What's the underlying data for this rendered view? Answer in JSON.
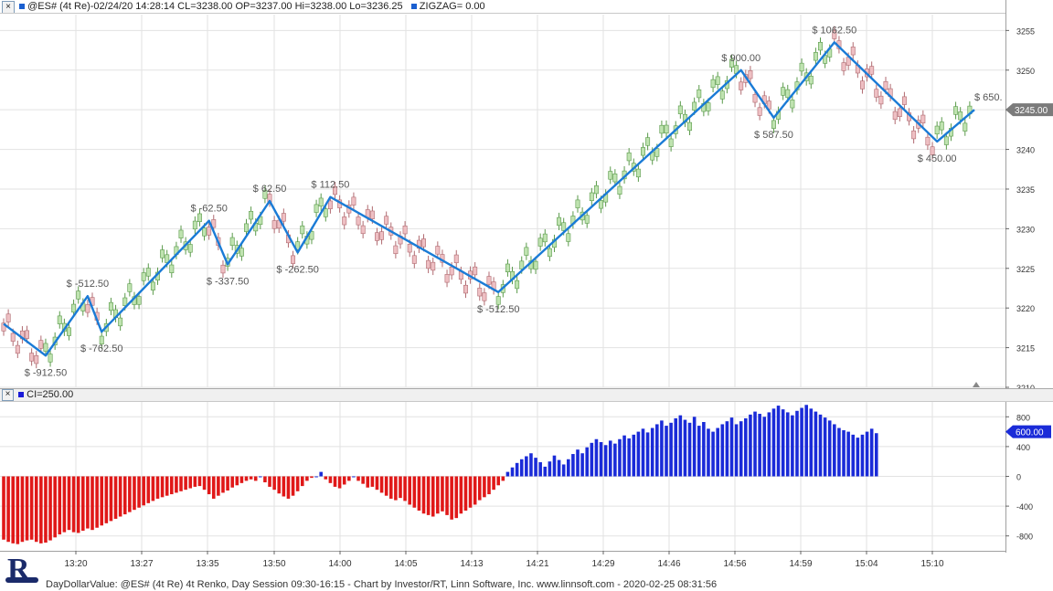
{
  "header": {
    "close_glyph": "×",
    "title": "@ES# (4t Re)-02/24/20 14:28:14 CL=3238.00 OP=3237.00 Hi=3238.00 Lo=3236.25",
    "indicator_label": "ZIGZAG= 0.00",
    "indicator_color": "#1a5fd0"
  },
  "lower_header": {
    "close_glyph": "×",
    "indicator_label": "CI=250.00",
    "indicator_color": "#1a1ad8"
  },
  "footer": {
    "text": "DayDollarValue: @ES# (4t Re) 4t Renko, Day Session 09:30-16:15 - Chart by Investor/RT, Linn Software, Inc. www.linnsoft.com - 2020-02-25 08:31:56",
    "logo_letter": "R"
  },
  "colors": {
    "up_brick": "#bfe3b0",
    "up_border": "#5a9a4a",
    "down_brick": "#eebfc3",
    "down_border": "#b06a70",
    "zigzag": "#1a7bd6",
    "pos_bar": "#1a2bd8",
    "neg_bar": "#e01818",
    "grid": "#e2e2e2",
    "axis_bg": "#ffffff",
    "price_marker_bg": "#7b7b7b",
    "ci_marker_bg": "#1a2bd8"
  },
  "chart_data": [
    {
      "type": "renko-candlestick",
      "title": "@ES# (4t Re)-02/24/20 14:28:14 CL=3238.00 OP=3237.00 Hi=3238.00 Lo=3236.25",
      "ylim": [
        3210,
        3257
      ],
      "y_ticks": [
        3210,
        3215,
        3220,
        3225,
        3230,
        3235,
        3240,
        3245,
        3250,
        3255
      ],
      "x_tick_labels": [
        "13:20",
        "13:27",
        "13:35",
        "13:50",
        "14:00",
        "14:05",
        "14:13",
        "14:21",
        "14:29",
        "14:46",
        "14:56",
        "14:59",
        "15:04",
        "15:10"
      ],
      "last_price_label": "3245.00",
      "brick_size": 1.0,
      "zigzag_series": {
        "name": "ZIGZAG",
        "points": [
          {
            "brick": 0,
            "price": 3218.0
          },
          {
            "brick": 9,
            "price": 3214.0
          },
          {
            "brick": 18,
            "price": 3221.5
          },
          {
            "brick": 21,
            "price": 3217.0
          },
          {
            "brick": 44,
            "price": 3231.0
          },
          {
            "brick": 48,
            "price": 3225.5
          },
          {
            "brick": 57,
            "price": 3233.5
          },
          {
            "brick": 63,
            "price": 3227.0
          },
          {
            "brick": 70,
            "price": 3234.0
          },
          {
            "brick": 106,
            "price": 3222.0
          },
          {
            "brick": 158,
            "price": 3250.0
          },
          {
            "brick": 165,
            "price": 3244.0
          },
          {
            "brick": 178,
            "price": 3253.5
          },
          {
            "brick": 200,
            "price": 3241.0
          },
          {
            "brick": 208,
            "price": 3245.0
          }
        ]
      },
      "annotations": [
        {
          "text": "$ -912.50",
          "brick": 9,
          "price": 3214.0,
          "position": "below"
        },
        {
          "text": "$ -512.50",
          "brick": 18,
          "price": 3221.5,
          "position": "above"
        },
        {
          "text": "$ -762.50",
          "brick": 21,
          "price": 3217.0,
          "position": "below"
        },
        {
          "text": "$ -62.50",
          "brick": 44,
          "price": 3231.0,
          "position": "above"
        },
        {
          "text": "$ -337.50",
          "brick": 48,
          "price": 3225.5,
          "position": "below"
        },
        {
          "text": "$ 62.50",
          "brick": 57,
          "price": 3233.5,
          "position": "above"
        },
        {
          "text": "$ -262.50",
          "brick": 63,
          "price": 3227.0,
          "position": "below"
        },
        {
          "text": "$ 112.50",
          "brick": 70,
          "price": 3234.0,
          "position": "above"
        },
        {
          "text": "$ -512.50",
          "brick": 106,
          "price": 3222.0,
          "position": "below"
        },
        {
          "text": "$ 900.00",
          "brick": 158,
          "price": 3250.0,
          "position": "above"
        },
        {
          "text": "$ 587.50",
          "brick": 165,
          "price": 3244.0,
          "position": "below"
        },
        {
          "text": "$ 1062.50",
          "brick": 178,
          "price": 3253.5,
          "position": "above"
        },
        {
          "text": "$ 450.00",
          "brick": 200,
          "price": 3241.0,
          "position": "below"
        },
        {
          "text": "$ 650.",
          "brick": 208,
          "price": 3245.0,
          "position": "above"
        }
      ]
    },
    {
      "type": "bar",
      "title": "CI=250.00",
      "ylim": [
        -1000,
        1000
      ],
      "y_ticks": [
        800,
        400,
        0,
        -400,
        -800
      ],
      "last_value_label": "600.00",
      "values": [
        -850,
        -880,
        -900,
        -910,
        -880,
        -860,
        -850,
        -880,
        -900,
        -890,
        -860,
        -820,
        -780,
        -750,
        -720,
        -750,
        -760,
        -730,
        -700,
        -720,
        -690,
        -660,
        -630,
        -600,
        -570,
        -540,
        -510,
        -480,
        -450,
        -420,
        -390,
        -360,
        -330,
        -300,
        -280,
        -260,
        -240,
        -220,
        -200,
        -180,
        -160,
        -140,
        -130,
        -180,
        -240,
        -300,
        -260,
        -220,
        -190,
        -150,
        -120,
        -90,
        -60,
        -40,
        -60,
        0,
        -80,
        -140,
        -180,
        -230,
        -270,
        -300,
        -260,
        -200,
        -130,
        -60,
        -20,
        0,
        60,
        -40,
        -90,
        -140,
        -160,
        -110,
        -60,
        0,
        -60,
        -100,
        -150,
        -140,
        -180,
        -220,
        -260,
        -300,
        -320,
        -290,
        -330,
        -380,
        -420,
        -460,
        -500,
        -520,
        -540,
        -500,
        -470,
        -520,
        -580,
        -560,
        -500,
        -460,
        -420,
        -380,
        -320,
        -280,
        -240,
        -180,
        -120,
        -60,
        60,
        120,
        180,
        230,
        270,
        310,
        250,
        190,
        130,
        200,
        280,
        220,
        160,
        230,
        300,
        360,
        310,
        390,
        450,
        500,
        460,
        420,
        480,
        440,
        500,
        550,
        510,
        560,
        600,
        640,
        590,
        650,
        700,
        750,
        680,
        720,
        780,
        820,
        760,
        720,
        800,
        680,
        730,
        640,
        600,
        650,
        700,
        740,
        790,
        700,
        740,
        780,
        830,
        870,
        840,
        800,
        860,
        910,
        950,
        900,
        860,
        820,
        880,
        920,
        960,
        910,
        870,
        830,
        790,
        750,
        700,
        650,
        620,
        600,
        560,
        520,
        560,
        600,
        640,
        580
      ],
      "series": [
        {
          "name": "CI",
          "color_positive": "#1a2bd8",
          "color_negative": "#e01818"
        }
      ]
    }
  ]
}
